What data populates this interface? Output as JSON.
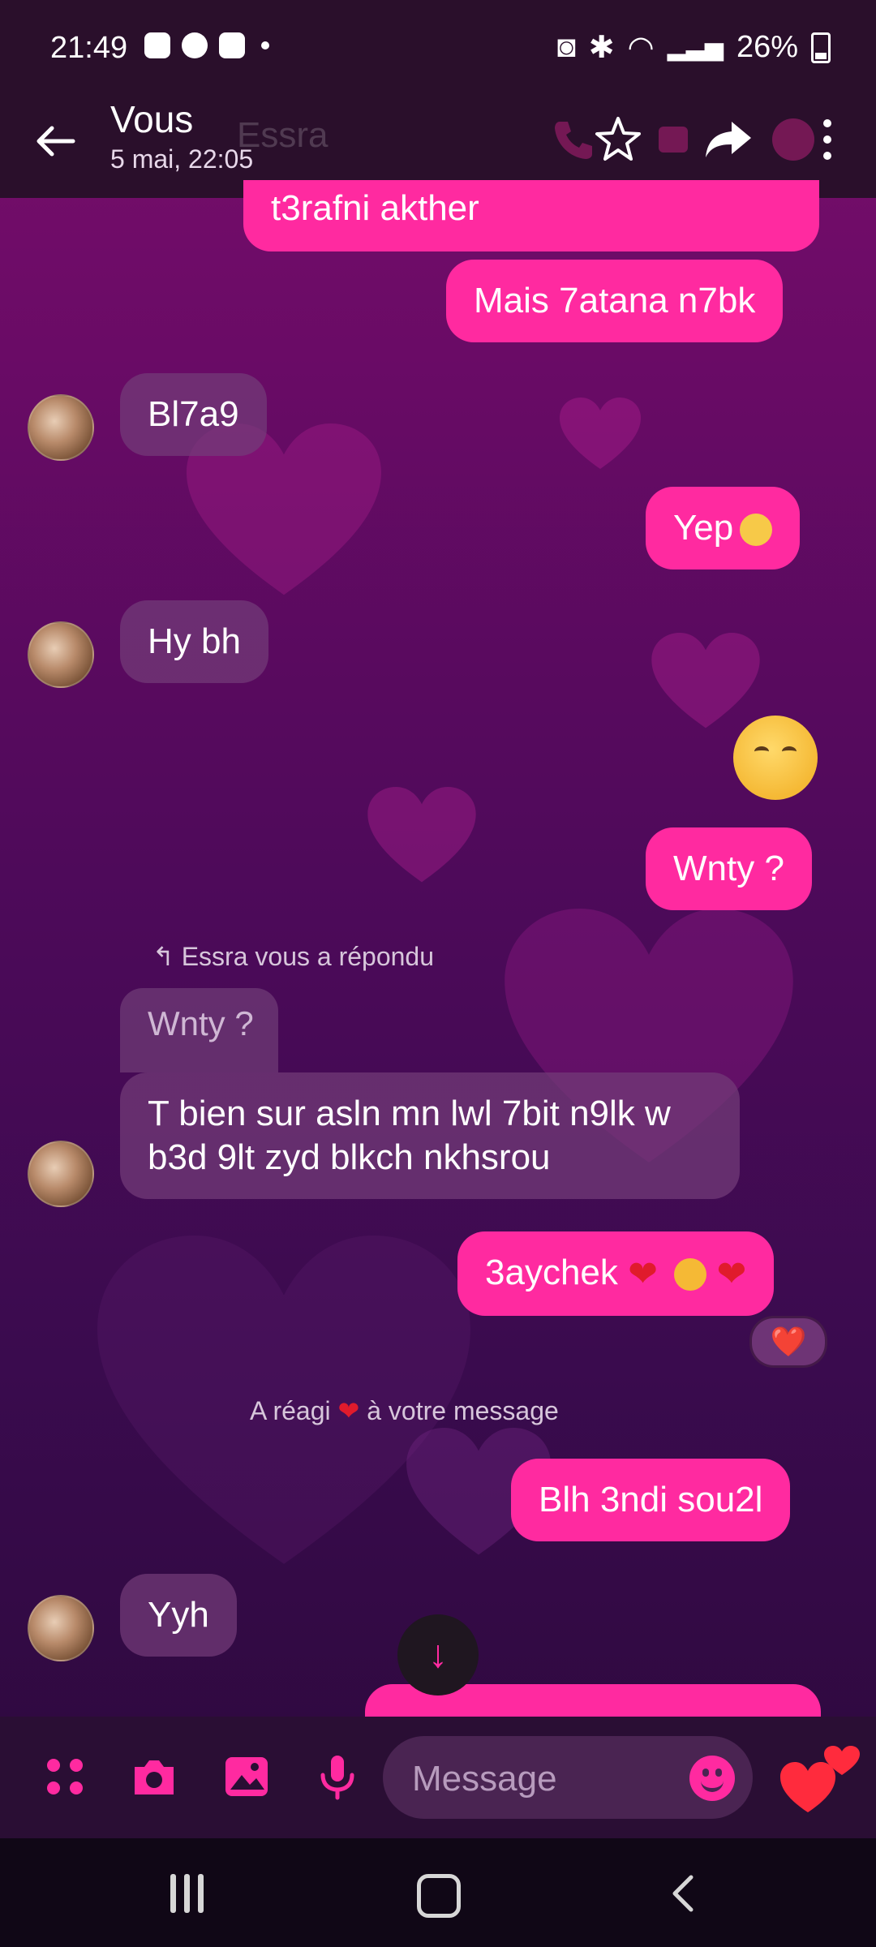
{
  "status_bar": {
    "time": "21:49",
    "battery": "26%",
    "icons": [
      "gallery-icon",
      "shazam-icon",
      "app-icon",
      "bluetooth-icon",
      "wifi-icon",
      "signal-icon",
      "battery-icon"
    ]
  },
  "header": {
    "title": "Vous",
    "subtitle": "5 mai, 22:05",
    "ghost_contact_name": "Essra",
    "actions": [
      "call-icon",
      "star-icon",
      "video-icon",
      "forward-icon",
      "info-icon",
      "more-icon"
    ]
  },
  "messages": [
    {
      "side": "out",
      "text": "t3rafni akther"
    },
    {
      "side": "out",
      "text": "Mais 7atana n7bk"
    },
    {
      "side": "in",
      "text": "Bl7a9"
    },
    {
      "side": "out",
      "text": "Yep"
    },
    {
      "side": "in",
      "text": "Hy bh"
    },
    {
      "side": "out",
      "text": "☺️"
    },
    {
      "side": "out",
      "text": "Wnty ?"
    },
    {
      "side": "in",
      "text": "T bien sur asln mn lwl 7bit n9lk w b3d 9lt zyd blkch nkhsrou",
      "reply_note": "Essra vous a répondu",
      "quoted": "Wnty ?"
    },
    {
      "side": "out",
      "text": "3aychek",
      "reaction": "❤️"
    },
    {
      "side": "out",
      "text": "Blh 3ndi sou2l"
    },
    {
      "side": "in",
      "text": "Yyh"
    }
  ],
  "system_note": {
    "before": "A réagi",
    "after": "à votre message"
  },
  "composer": {
    "placeholder": "Message",
    "buttons": [
      "menu-dots-icon",
      "camera-icon",
      "gallery-icon",
      "microphone-icon",
      "emoji-icon",
      "hearts-icon"
    ]
  },
  "colors": {
    "accent": "#ff2aa0",
    "bar_bg": "#2a0f2b",
    "incoming_bubble": "#733c78"
  }
}
